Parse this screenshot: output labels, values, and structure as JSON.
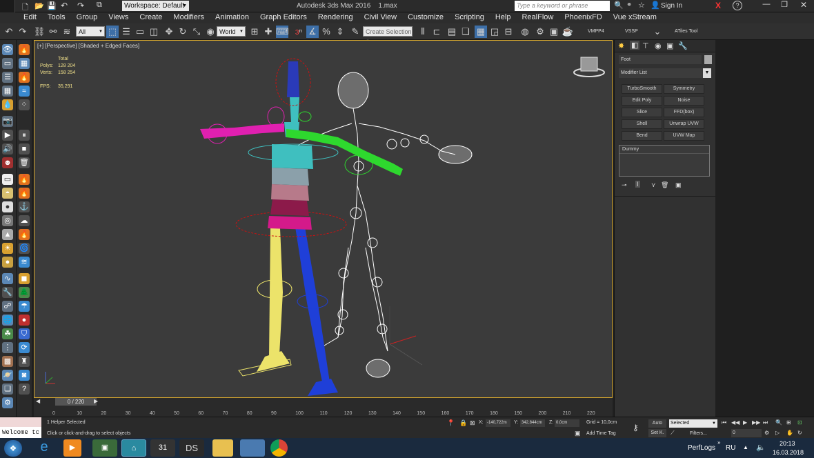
{
  "title": {
    "workspace": "Workspace: Default",
    "app": "Autodesk 3ds Max 2016",
    "file": "1.max",
    "search_placeholder": "Type a keyword or phrase",
    "signin": "Sign In",
    "help": "?"
  },
  "menu": [
    "Edit",
    "Tools",
    "Group",
    "Views",
    "Create",
    "Modifiers",
    "Animation",
    "Graph Editors",
    "Rendering",
    "Civil View",
    "Customize",
    "Scripting",
    "Help",
    "RealFlow",
    "PhoenixFD",
    "Vue xStream"
  ],
  "toolbar": {
    "filter": "All",
    "coord": "World",
    "number": "3",
    "selection_set": "Create Selection S",
    "vmpp": "VMPP4",
    "vssp": "VSSP",
    "atiles": "ATiles Tool"
  },
  "viewport": {
    "label": "[+] [Perspective] [Shaded + Edged Faces]",
    "stats_total": "Total",
    "polys_label": "Polys:",
    "polys": "128 204",
    "verts_label": "Verts:",
    "verts": "158 254",
    "fps_label": "FPS:",
    "fps": "35,291"
  },
  "timeline": {
    "frame": "0 / 220",
    "ticks": [
      "0",
      "10",
      "20",
      "30",
      "40",
      "50",
      "60",
      "70",
      "80",
      "90",
      "100",
      "110",
      "120",
      "130",
      "140",
      "150",
      "160",
      "170",
      "180",
      "190",
      "200",
      "210",
      "220"
    ]
  },
  "command_panel": {
    "object_name": "Foot",
    "modifier_list": "Modifier List",
    "buttons": [
      "TurboSmooth",
      "Symmetry",
      "Edit Poly",
      "Noise",
      "Slice",
      "FFD(box)",
      "Shell",
      "Unwrap UVW",
      "Bend",
      "UVW Map"
    ],
    "stack_item": "Dummy"
  },
  "status": {
    "selected": "1 Helper Selected",
    "prompt": "Click or click-and-drag to select objects",
    "welcome": "Welcome tc",
    "x_label": "X:",
    "x": "-140,722m",
    "y_label": "Y:",
    "y": "342,844cm",
    "z_label": "Z:",
    "z": "0,0cm",
    "grid": "Grid = 10,0cm",
    "add_time_tag": "Add Time Tag",
    "auto": "Auto",
    "setk": "Set K.",
    "key_mode": "Selected",
    "filters": "Filters...",
    "frame_field": "0"
  },
  "taskbar": {
    "perflogs": "PerfLogs",
    "lang": "RU",
    "time": "20:13",
    "date": "16.03.2018",
    "ds": "DS",
    "cal": "31"
  }
}
